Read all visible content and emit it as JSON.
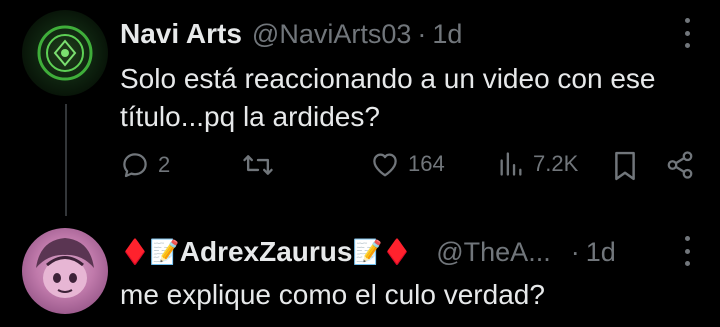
{
  "tweets": [
    {
      "name": "Navi Arts",
      "handle": "@NaviArts03",
      "separator": "·",
      "time": "1d",
      "text": "Solo está reaccionando a un video con ese título...pq la ardides?",
      "actions": {
        "replies": "2",
        "retweets": "",
        "likes": "164",
        "views": "7.2K"
      }
    },
    {
      "name_prefix": "♦️📝",
      "name": "AdrexZaurus",
      "name_suffix": "📝♦️",
      "handle": "@TheA...",
      "separator": "·",
      "time": "1d",
      "text": "me explique como el culo verdad?"
    }
  ],
  "colors": {
    "background": "#000000",
    "primary_text": "#e7e9ea",
    "secondary_text": "#71767b",
    "thread_line": "#333639",
    "diamond_red": "#e8112d"
  },
  "icons": [
    "more-icon",
    "reply-icon",
    "retweet-icon",
    "like-icon",
    "views-icon",
    "bookmark-icon",
    "share-icon"
  ]
}
